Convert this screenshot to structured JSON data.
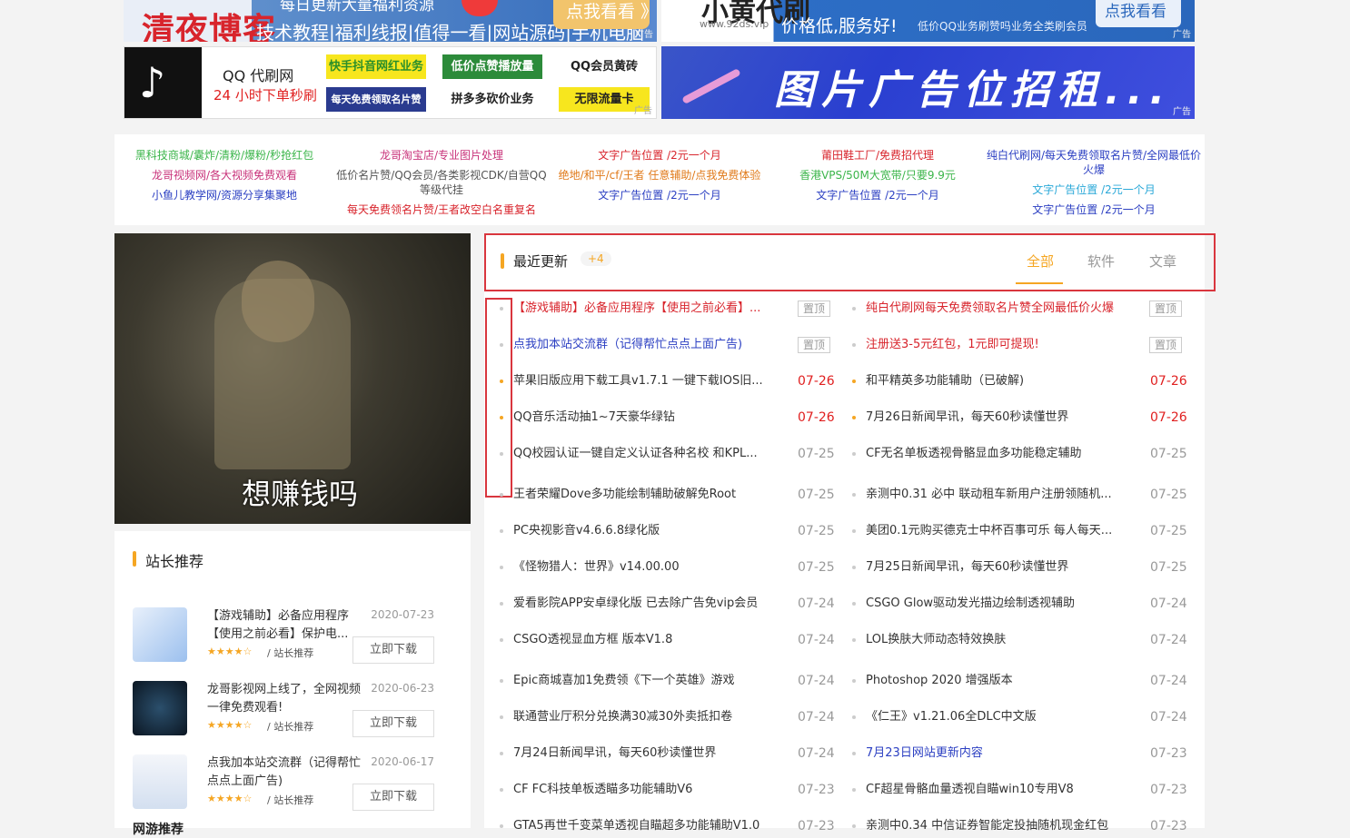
{
  "banners": {
    "b1": {
      "logo": "清夜博客",
      "line1": "每日更新大量福利资源",
      "line2": "技术教程|福利线报|值得一看|网站源码|手机电脑软件",
      "button": "点我看看 》",
      "ad": "广告"
    },
    "b2": {
      "logo": "小黄代刷",
      "sub": "www.92ds.vip",
      "line1": "价格低,服务好!",
      "line2": "低价QQ业务刷赞吗业务全类刷会员",
      "button": "点我看看",
      "ad": "广告"
    },
    "b3": {
      "title1": "QQ 代刷网",
      "title2": "24 小时下单秒刷",
      "cells": [
        "快手抖音网红业务",
        "低价点赞播放量",
        "QQ会员黄砖",
        "每天免费领取名片赞",
        "拼多多砍价业务",
        "无限流量卡"
      ],
      "ad": "广告"
    },
    "b4": {
      "text": "图片广告位招租...",
      "ad": "广告"
    }
  },
  "text_links": {
    "col1": [
      "黑科技商城/囊炸/清粉/爆粉/秒抢红包",
      "龙哥视频网/各大视频免费观看",
      "小鱼儿教学网/资源分享集聚地"
    ],
    "col2": [
      "龙哥淘宝店/专业图片处理",
      "低价名片赞/QQ会员/各类影视CDK/自营QQ等级代挂",
      "每天免费领名片赞/王者改空白名重复名"
    ],
    "col3": [
      "文字广告位置 /2元一个月",
      "绝地/和平/cf/王者 任意辅助/点我免费体验",
      "文字广告位置 /2元一个月"
    ],
    "col4": [
      "莆田鞋工厂/免费招代理",
      "香港VPS/50M大宽带/只要9.9元",
      "文字广告位置 /2元一个月"
    ],
    "col5": [
      "纯白代刷网/每天免费领取名片赞/全网最低价火爆",
      "文字广告位置 /2元一个月",
      "文字广告位置 /2元一个月"
    ]
  },
  "video": {
    "caption": "想赚钱吗"
  },
  "recommend": {
    "title": "站长推荐",
    "items": [
      {
        "title": "【游戏辅助】必备应用程序【使用之前必看】保护电...",
        "date": "2020-07-23",
        "stars": "★★★★☆",
        "source": "/ 站长推荐",
        "button": "立即下载"
      },
      {
        "title": "龙哥影视网上线了，全网视频一律免费观看!",
        "date": "2020-06-23",
        "stars": "★★★★☆",
        "source": "/ 站长推荐",
        "button": "立即下载"
      },
      {
        "title": "点我加本站交流群（记得帮忙点点上面广告)",
        "date": "2020-06-17",
        "stars": "★★★★☆",
        "source": "/ 站长推荐",
        "button": "立即下载"
      }
    ],
    "more": "网游推荐"
  },
  "updates": {
    "title": "最近更新",
    "badge": "+4",
    "tabs": [
      "全部",
      "软件",
      "文章"
    ],
    "top_label": "置顶",
    "left": [
      {
        "title": "【游戏辅助】必备应用程序【使用之前必看】...",
        "date": "",
        "top": true,
        "color": "#d8242c",
        "dot": "#ccc"
      },
      {
        "title": "点我加本站交流群（记得帮忙点点上面广告)",
        "date": "",
        "top": true,
        "color": "#2b3fc2",
        "dot": "#ccc"
      },
      {
        "title": "苹果旧版应用下载工具v1.7.1 一键下载IOS旧...",
        "date": "07-26",
        "top": false,
        "color": "#333",
        "dot": "#f5a623",
        "dcolor": "#e02020"
      },
      {
        "title": "QQ音乐活动抽1~7天豪华绿钻",
        "date": "07-26",
        "top": false,
        "color": "#333",
        "dot": "#f5a623",
        "dcolor": "#e02020"
      },
      {
        "title": "QQ校园认证一键自定义认证各种名校 和KPL...",
        "date": "07-25",
        "top": false,
        "color": "#333",
        "dot": "#ccc",
        "dcolor": "#999"
      },
      {
        "title": "王者荣耀Dove多功能绘制辅助破解免Root",
        "date": "07-25",
        "top": false,
        "color": "#333",
        "dot": "#ccc",
        "dcolor": "#999"
      },
      {
        "title": "PC央视影音v4.6.6.8绿化版",
        "date": "07-25",
        "top": false,
        "color": "#333",
        "dot": "#ccc",
        "dcolor": "#999"
      },
      {
        "title": "《怪物猎人：世界》v14.00.00",
        "date": "07-25",
        "top": false,
        "color": "#333",
        "dot": "#ccc",
        "dcolor": "#999"
      },
      {
        "title": "爱看影院APP安卓绿化版 已去除广告免vip会员",
        "date": "07-24",
        "top": false,
        "color": "#333",
        "dot": "#ccc",
        "dcolor": "#999"
      },
      {
        "title": "CSGO透视显血方框 版本V1.8",
        "date": "07-24",
        "top": false,
        "color": "#333",
        "dot": "#ccc",
        "dcolor": "#999"
      },
      {
        "title": "Epic商城喜加1免费领《下一个英雄》游戏",
        "date": "07-24",
        "top": false,
        "color": "#333",
        "dot": "#ccc",
        "dcolor": "#999"
      },
      {
        "title": "联通营业厅积分兑换满30减30外卖抵扣卷",
        "date": "07-24",
        "top": false,
        "color": "#333",
        "dot": "#ccc",
        "dcolor": "#999"
      },
      {
        "title": "7月24日新闻早讯，每天60秒读懂世界",
        "date": "07-24",
        "top": false,
        "color": "#333",
        "dot": "#ccc",
        "dcolor": "#999"
      },
      {
        "title": "CF FC科技单板透瞄多功能辅助V6",
        "date": "07-23",
        "top": false,
        "color": "#333",
        "dot": "#ccc",
        "dcolor": "#999"
      },
      {
        "title": "GTA5再世千变菜单透视自瞄超多功能辅助V1.0",
        "date": "07-23",
        "top": false,
        "color": "#333",
        "dot": "#ccc",
        "dcolor": "#999"
      }
    ],
    "right": [
      {
        "title": "纯白代刷网每天免费领取名片赞全网最低价火爆",
        "date": "",
        "top": true,
        "color": "#d8242c",
        "dot": "#ccc"
      },
      {
        "title": "注册送3-5元红包，1元即可提现!",
        "date": "",
        "top": true,
        "color": "#d8242c",
        "dot": "#ccc"
      },
      {
        "title": "和平精英多功能辅助（已破解)",
        "date": "07-26",
        "top": false,
        "color": "#333",
        "dot": "#f5a623",
        "dcolor": "#e02020"
      },
      {
        "title": "7月26日新闻早讯，每天60秒读懂世界",
        "date": "07-26",
        "top": false,
        "color": "#333",
        "dot": "#f5a623",
        "dcolor": "#e02020"
      },
      {
        "title": "CF无名单板透视骨骼显血多功能稳定辅助",
        "date": "07-25",
        "top": false,
        "color": "#333",
        "dot": "#ccc",
        "dcolor": "#999"
      },
      {
        "title": "亲测中0.31 必中 联动租车新用户注册领随机...",
        "date": "07-25",
        "top": false,
        "color": "#333",
        "dot": "#ccc",
        "dcolor": "#999"
      },
      {
        "title": "美团0.1元购买德克士中杯百事可乐 每人每天...",
        "date": "07-25",
        "top": false,
        "color": "#333",
        "dot": "#ccc",
        "dcolor": "#999"
      },
      {
        "title": "7月25日新闻早讯，每天60秒读懂世界",
        "date": "07-25",
        "top": false,
        "color": "#333",
        "dot": "#ccc",
        "dcolor": "#999"
      },
      {
        "title": "CSGO Glow驱动发光描边绘制透视辅助",
        "date": "07-24",
        "top": false,
        "color": "#333",
        "dot": "#ccc",
        "dcolor": "#999"
      },
      {
        "title": "LOL换肤大师动态特效换肤",
        "date": "07-24",
        "top": false,
        "color": "#333",
        "dot": "#ccc",
        "dcolor": "#999"
      },
      {
        "title": "Photoshop 2020 增强版本",
        "date": "07-24",
        "top": false,
        "color": "#333",
        "dot": "#ccc",
        "dcolor": "#999"
      },
      {
        "title": "《仁王》v1.21.06全DLC中文版",
        "date": "07-24",
        "top": false,
        "color": "#333",
        "dot": "#ccc",
        "dcolor": "#999"
      },
      {
        "title": "7月23日网站更新内容",
        "date": "07-23",
        "top": false,
        "color": "#2b3fc2",
        "dot": "#ccc",
        "dcolor": "#999"
      },
      {
        "title": "CF超星骨骼血量透视自瞄win10专用V8",
        "date": "07-23",
        "top": false,
        "color": "#333",
        "dot": "#ccc",
        "dcolor": "#999"
      },
      {
        "title": "亲测中0.34 中信证券智能定投抽随机现金红包",
        "date": "07-23",
        "top": false,
        "color": "#333",
        "dot": "#ccc",
        "dcolor": "#999"
      }
    ]
  },
  "colors": {
    "accent": "#f5a623",
    "highlight_box": "#d9363e",
    "new_date": "#e02020"
  }
}
